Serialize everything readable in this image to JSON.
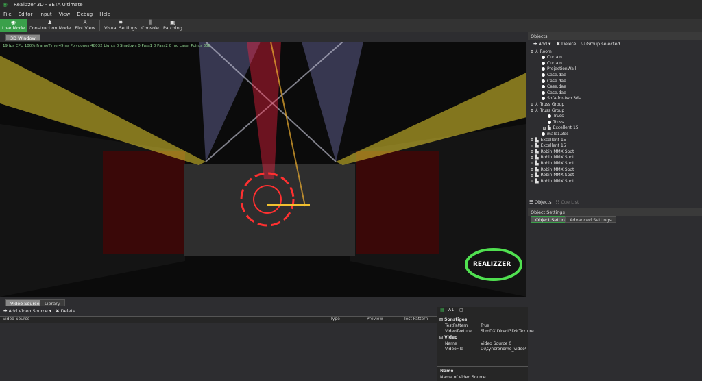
{
  "window": {
    "title": "Realizzer 3D - BETA  Ultimate"
  },
  "menu": [
    "File",
    "Editor",
    "Input",
    "View",
    "Debug",
    "Help"
  ],
  "toolbar": [
    {
      "label": "Live Mode",
      "icon": "eye-icon",
      "active": true
    },
    {
      "label": "Construction Mode",
      "icon": "person-icon"
    },
    {
      "label": "Plot View",
      "icon": "tripod-icon"
    },
    {
      "label": "Visual Settings",
      "icon": "sun-icon"
    },
    {
      "label": "Console",
      "icon": "sliders-icon"
    },
    {
      "label": "Patching",
      "icon": "plug-icon"
    }
  ],
  "viewport": {
    "tab": "3D Window",
    "stats": "19 fps CPU  100% FrameTime  49ms  Polygones  48032 Lights  0 Shadows  0 Pass1  0 Pass2  0 Inc  Laser Points  358",
    "logo": "REALIZZER"
  },
  "objects": {
    "title": "Objects",
    "add": "Add",
    "delete": "Delete",
    "group": "Group selected",
    "tree": [
      {
        "label": "Room",
        "lvl": 0,
        "type": "group"
      },
      {
        "label": "Curtain",
        "lvl": 1,
        "type": "obj"
      },
      {
        "label": "Curtain",
        "lvl": 1,
        "type": "obj"
      },
      {
        "label": "ProjectionWall",
        "lvl": 1,
        "type": "obj"
      },
      {
        "label": "Case.dae",
        "lvl": 1,
        "type": "obj"
      },
      {
        "label": "Case.dae",
        "lvl": 1,
        "type": "obj"
      },
      {
        "label": "Case.dae",
        "lvl": 1,
        "type": "obj"
      },
      {
        "label": "Case.dae",
        "lvl": 1,
        "type": "obj"
      },
      {
        "label": "Sofa-for-two.3ds",
        "lvl": 1,
        "type": "obj"
      },
      {
        "label": "Truss Group",
        "lvl": 0,
        "type": "group"
      },
      {
        "label": "Truss Group",
        "lvl": 0,
        "type": "group"
      },
      {
        "label": "Truss",
        "lvl": 2,
        "type": "obj"
      },
      {
        "label": "Truss",
        "lvl": 2,
        "type": "obj"
      },
      {
        "label": "Excellent 15",
        "lvl": 2,
        "type": "fixture"
      },
      {
        "label": "male1.3ds",
        "lvl": 1,
        "type": "obj"
      },
      {
        "label": "Excellent 15",
        "lvl": 0,
        "type": "fixture"
      },
      {
        "label": "Excellent 15",
        "lvl": 0,
        "type": "fixture"
      },
      {
        "label": "Robin MMX Spot",
        "lvl": 0,
        "type": "fixture"
      },
      {
        "label": "Robin MMX Spot",
        "lvl": 0,
        "type": "fixture"
      },
      {
        "label": "Robin MMX Spot",
        "lvl": 0,
        "type": "fixture"
      },
      {
        "label": "Robin MMX Spot",
        "lvl": 0,
        "type": "fixture"
      },
      {
        "label": "Robin MMX Spot",
        "lvl": 0,
        "type": "fixture"
      },
      {
        "label": "Robin MMX Spot",
        "lvl": 0,
        "type": "fixture"
      }
    ],
    "tabs": [
      "Objects",
      "Cue List"
    ]
  },
  "settings": {
    "title": "Object Settings",
    "tabs": [
      "Object Settings",
      "Advanced Settings"
    ]
  },
  "bottom": {
    "tabs": [
      "Video Sources",
      "Library"
    ],
    "add": "Add Video Source",
    "delete": "Delete",
    "columns": [
      "Video Source",
      "Type",
      "Preview",
      "Test Pattern"
    ]
  },
  "props": {
    "cat1": "Sonstiges",
    "cat2": "Video",
    "rows1": [
      [
        "TestPattern",
        "True"
      ],
      [
        "VideoTexture",
        "SlimDX.Direct3D9.Texture"
      ]
    ],
    "rows2": [
      [
        "Name",
        "Video Source 0"
      ],
      [
        "VideoFile",
        "D:\\syncronome_video\\"
      ]
    ],
    "desc_title": "Name",
    "desc": "Name of Video Source"
  },
  "colors": {
    "accent": "#3aa04a",
    "laser": "#ff3030",
    "beam_yellow": "#e8d030"
  }
}
